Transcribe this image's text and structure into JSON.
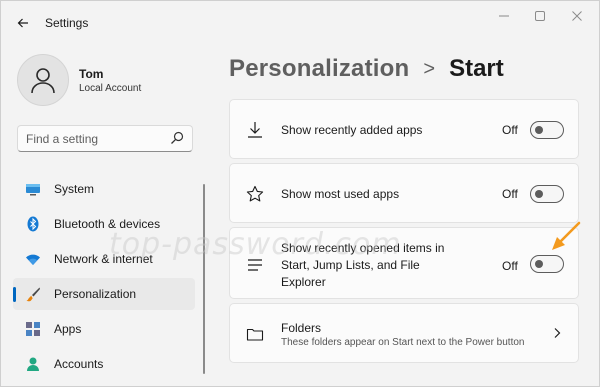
{
  "window": {
    "title": "Settings",
    "controls": [
      "minimize-icon",
      "maximize-icon",
      "close-icon"
    ]
  },
  "profile": {
    "name": "Tom",
    "account_type": "Local Account"
  },
  "search": {
    "placeholder": "Find a setting"
  },
  "nav": {
    "items": [
      {
        "label": "System",
        "icon": "system-icon",
        "active": false
      },
      {
        "label": "Bluetooth & devices",
        "icon": "bluetooth-icon",
        "active": false
      },
      {
        "label": "Network & internet",
        "icon": "wifi-icon",
        "active": false
      },
      {
        "label": "Personalization",
        "icon": "brush-icon",
        "active": true
      },
      {
        "label": "Apps",
        "icon": "apps-icon",
        "active": false
      },
      {
        "label": "Accounts",
        "icon": "person-icon",
        "active": false
      }
    ]
  },
  "breadcrumb": {
    "parent": "Personalization",
    "separator": ">",
    "current": "Start"
  },
  "settings": [
    {
      "label": "Show recently added apps",
      "state": "Off",
      "icon": "download-icon"
    },
    {
      "label": "Show most used apps",
      "state": "Off",
      "icon": "star-icon"
    },
    {
      "label": "Show recently opened items in Start, Jump Lists, and File Explorer",
      "state": "Off",
      "icon": "list-icon"
    }
  ],
  "folders": {
    "label": "Folders",
    "description": "These folders appear on Start next to the Power button",
    "icon": "folder-icon"
  },
  "watermark": "top-password.com",
  "colors": {
    "accent": "#0067c0",
    "annotation_arrow": "#f39a1e",
    "window_bg": "#f3f3f3",
    "card_bg": "#fbfbfb"
  }
}
